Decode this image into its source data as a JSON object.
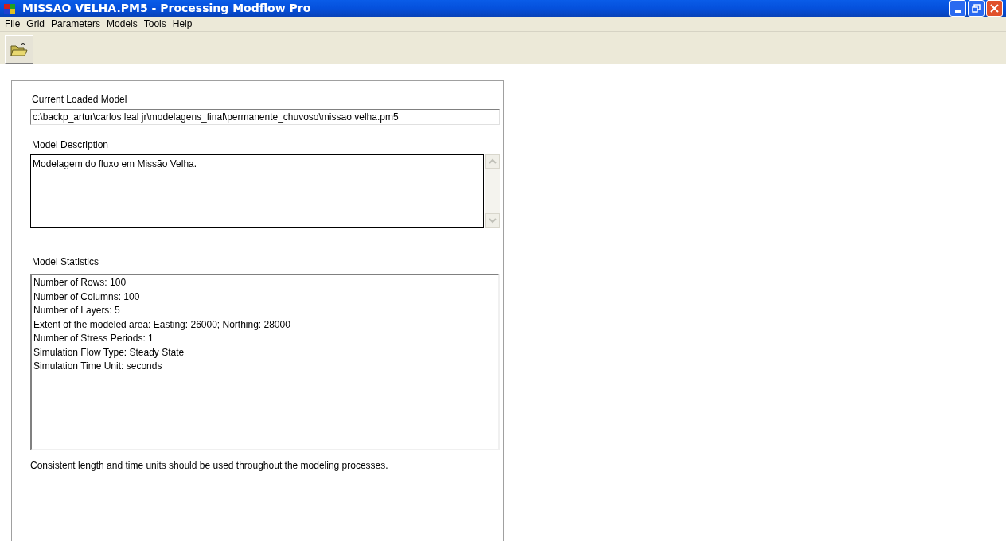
{
  "window": {
    "title": "MISSAO VELHA.PM5 - Processing Modflow Pro"
  },
  "menu": [
    "File",
    "Grid",
    "Parameters",
    "Models",
    "Tools",
    "Help"
  ],
  "panel": {
    "current_model": {
      "label": "Current Loaded Model",
      "value": "c:\\backp_artur\\carlos leal jr\\modelagens_final\\permanente_chuvoso\\missao velha.pm5"
    },
    "description": {
      "label": "Model Description",
      "value": "Modelagem do fluxo em Missão Velha."
    },
    "statistics": {
      "label": "Model Statistics",
      "lines": [
        "Number of Rows: 100",
        "Number of Columns: 100",
        "Number of Layers: 5",
        "Extent of the modeled area: Easting: 26000; Northing: 28000",
        "Number of Stress Periods: 1",
        "Simulation Flow Type: Steady State",
        "Simulation Time Unit: seconds"
      ]
    },
    "note": "Consistent length and time units should be used throughout the modeling processes."
  }
}
